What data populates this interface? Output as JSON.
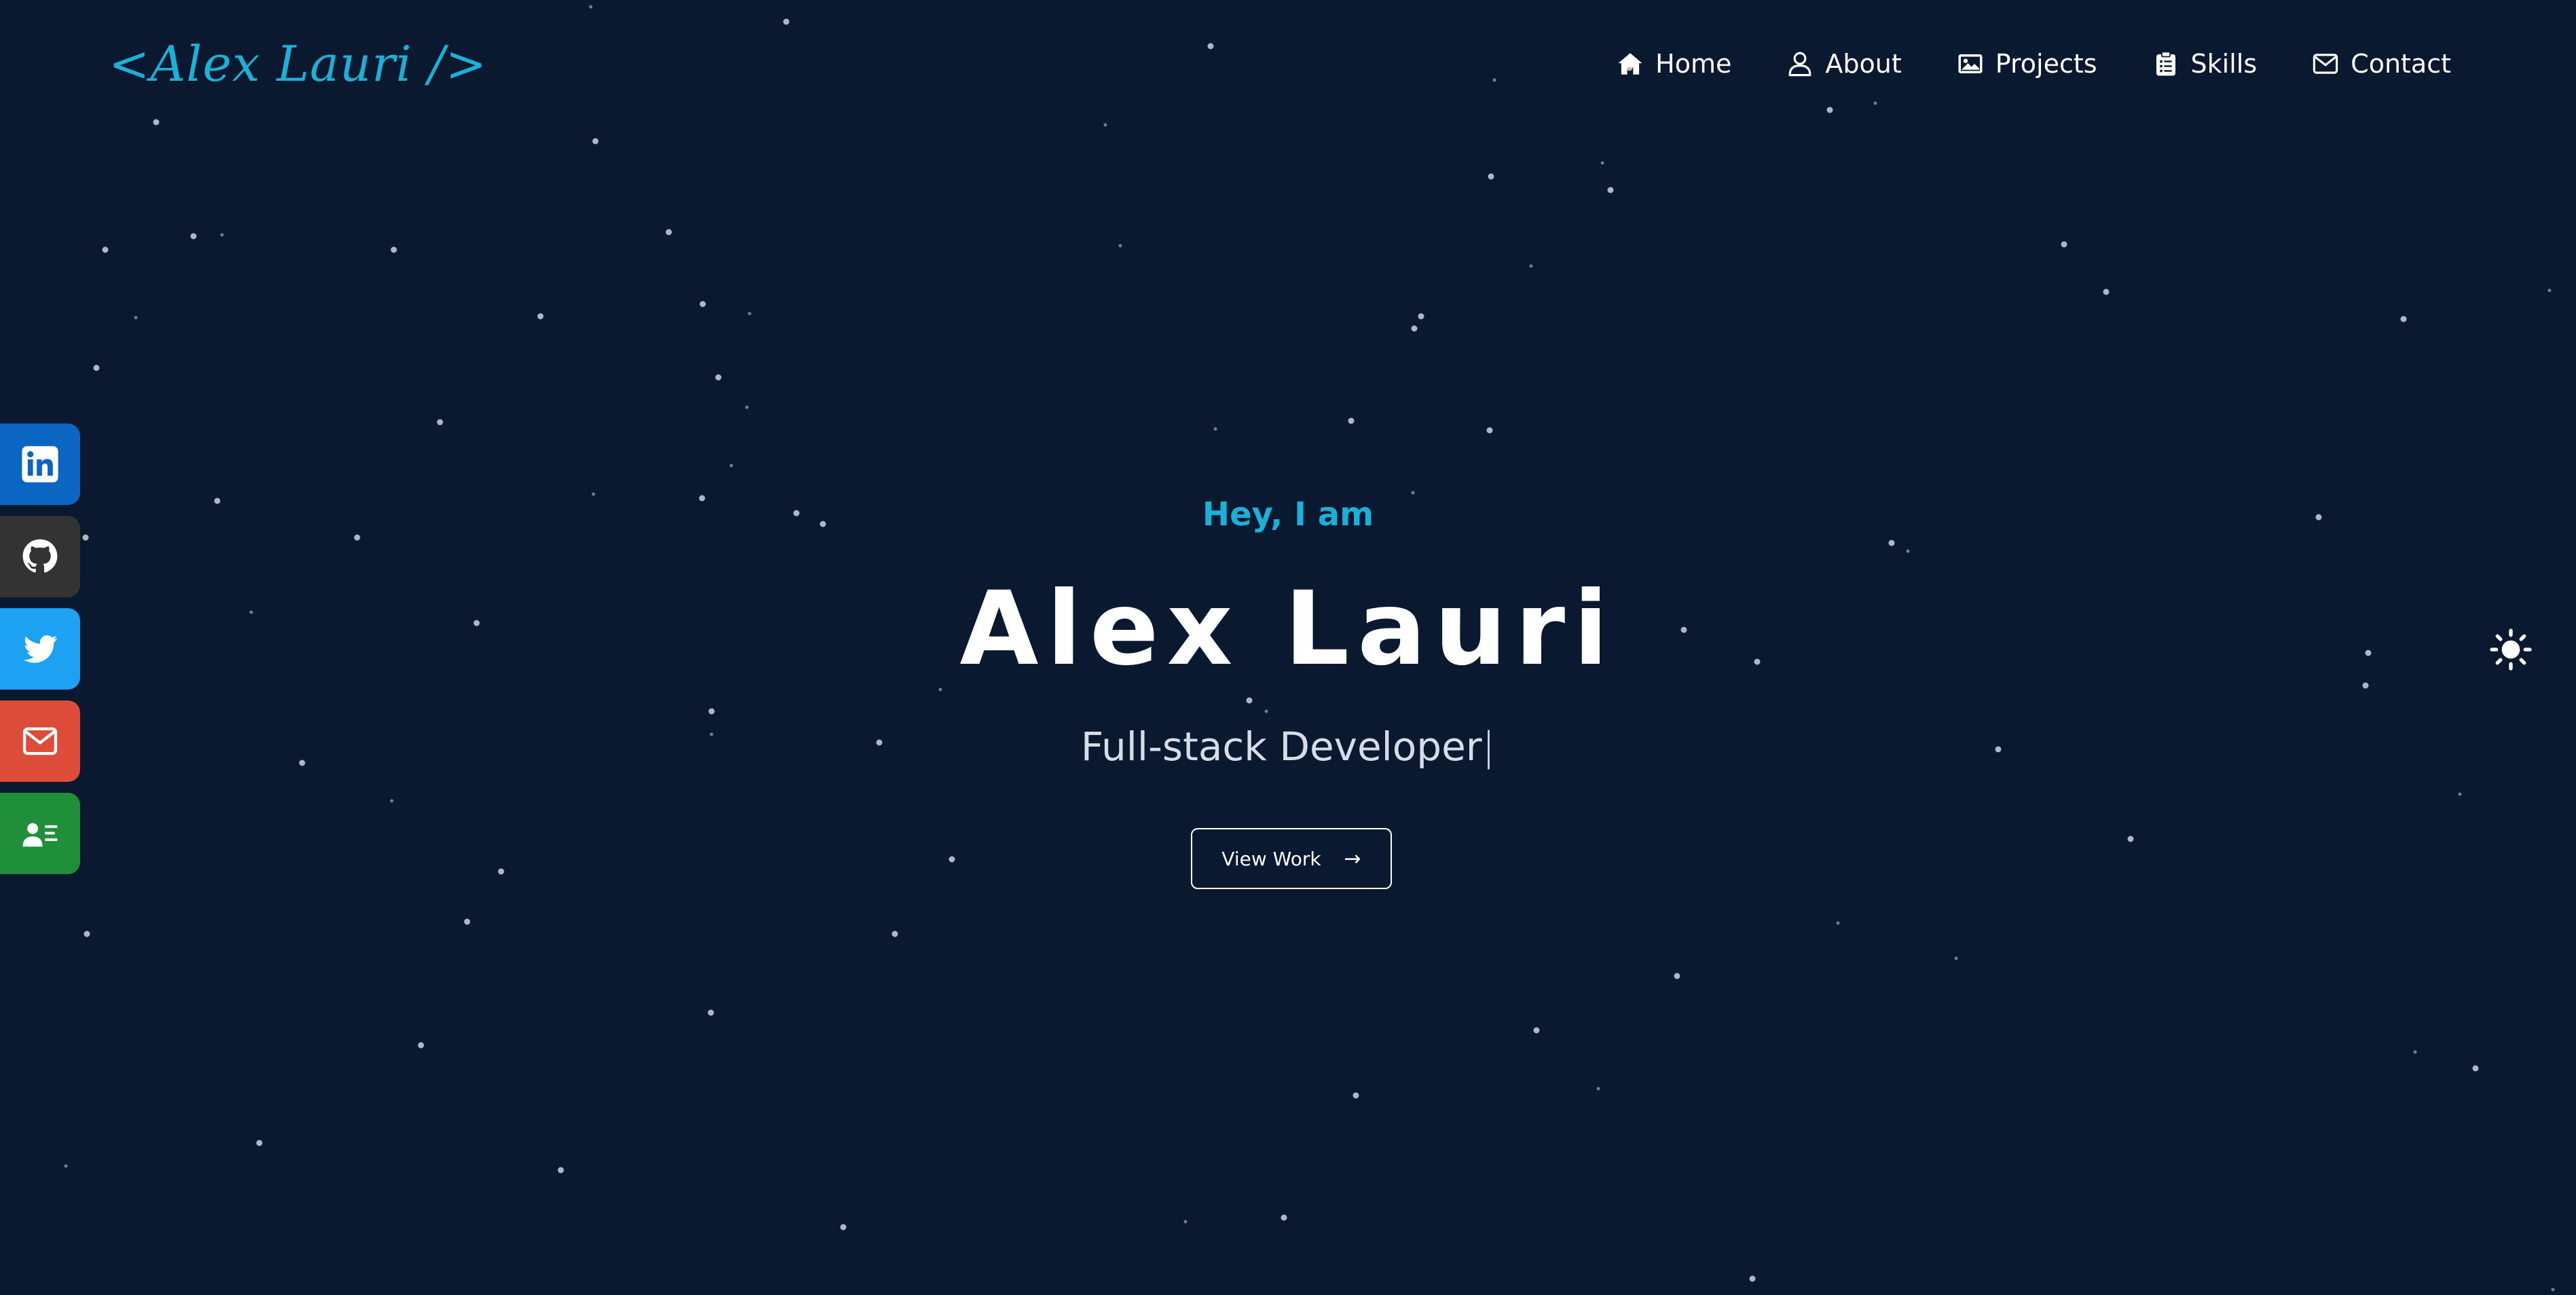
{
  "header": {
    "logo": "<Alex Lauri />"
  },
  "nav": {
    "items": [
      {
        "label": "Home",
        "icon": "home-icon"
      },
      {
        "label": "About",
        "icon": "user-icon"
      },
      {
        "label": "Projects",
        "icon": "image-icon"
      },
      {
        "label": "Skills",
        "icon": "clipboard-icon"
      },
      {
        "label": "Contact",
        "icon": "envelope-icon"
      }
    ]
  },
  "social": [
    {
      "name": "LinkedIn",
      "icon": "linkedin-icon",
      "color": "#0a66c2"
    },
    {
      "name": "GitHub",
      "icon": "github-icon",
      "color": "#333333"
    },
    {
      "name": "Twitter",
      "icon": "twitter-icon",
      "color": "#1da1f2"
    },
    {
      "name": "Email",
      "icon": "envelope-icon",
      "color": "#dd4b39"
    },
    {
      "name": "Resume",
      "icon": "contact-card-icon",
      "color": "#1f8f3a"
    }
  ],
  "hero": {
    "greeting": "Hey, I am",
    "name": "Alex Lauri",
    "role": "Full-stack Developer",
    "cursor": "|",
    "button_label": "View Work",
    "button_arrow": "→"
  },
  "theme": {
    "toggle_icon": "sun-icon"
  },
  "colors": {
    "background": "#0a192f",
    "accent": "#1ab0d8",
    "text": "#ffffff"
  }
}
